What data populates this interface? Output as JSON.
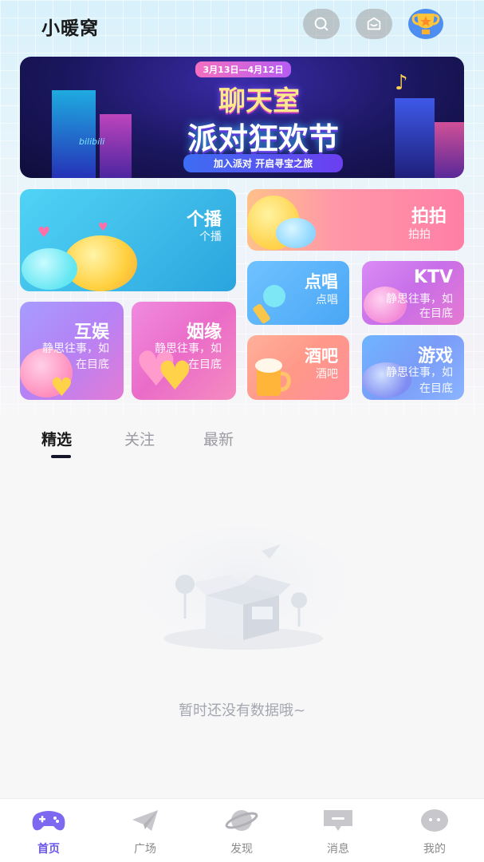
{
  "header": {
    "app_title": "小暖窝"
  },
  "banner": {
    "date": "3月13日—4月12日",
    "title_line1": "聊天室",
    "title_line2": "派对狂欢节",
    "subtitle": "加入派对 开启寻宝之旅",
    "logo": "bilibili"
  },
  "categories": {
    "gebo": {
      "title": "个播",
      "subtitle": "个播"
    },
    "paipai": {
      "title": "拍拍",
      "subtitle": "拍拍"
    },
    "dianchang": {
      "title": "点唱",
      "subtitle": "点唱"
    },
    "ktv": {
      "title": "KTV",
      "desc1": "静思往事，如",
      "desc2": "在目底"
    },
    "huyu": {
      "title": "互娱",
      "desc1": "静思往事，如",
      "desc2": "在目底"
    },
    "yinyuan": {
      "title": "姻缘",
      "desc1": "静思往事，如",
      "desc2": "在目底"
    },
    "jiuba": {
      "title": "酒吧",
      "subtitle": "酒吧"
    },
    "youxi": {
      "title": "游戏",
      "desc1": "静思往事，如",
      "desc2": "在目底"
    }
  },
  "tabs": [
    {
      "label": "精选",
      "active": true
    },
    {
      "label": "关注",
      "active": false
    },
    {
      "label": "最新",
      "active": false
    }
  ],
  "empty_state": {
    "message": "暂时还没有数据哦~"
  },
  "bottom_nav": [
    {
      "label": "首页",
      "icon": "gamepad-icon",
      "active": true
    },
    {
      "label": "广场",
      "icon": "paper-plane-icon",
      "active": false
    },
    {
      "label": "发现",
      "icon": "planet-icon",
      "active": false
    },
    {
      "label": "消息",
      "icon": "message-icon",
      "active": false
    },
    {
      "label": "我的",
      "icon": "profile-face-icon",
      "active": false
    }
  ],
  "colors": {
    "accent": "#6b57ea",
    "inactive_nav": "#8a8a8a",
    "empty_text": "#a5a7b0"
  }
}
